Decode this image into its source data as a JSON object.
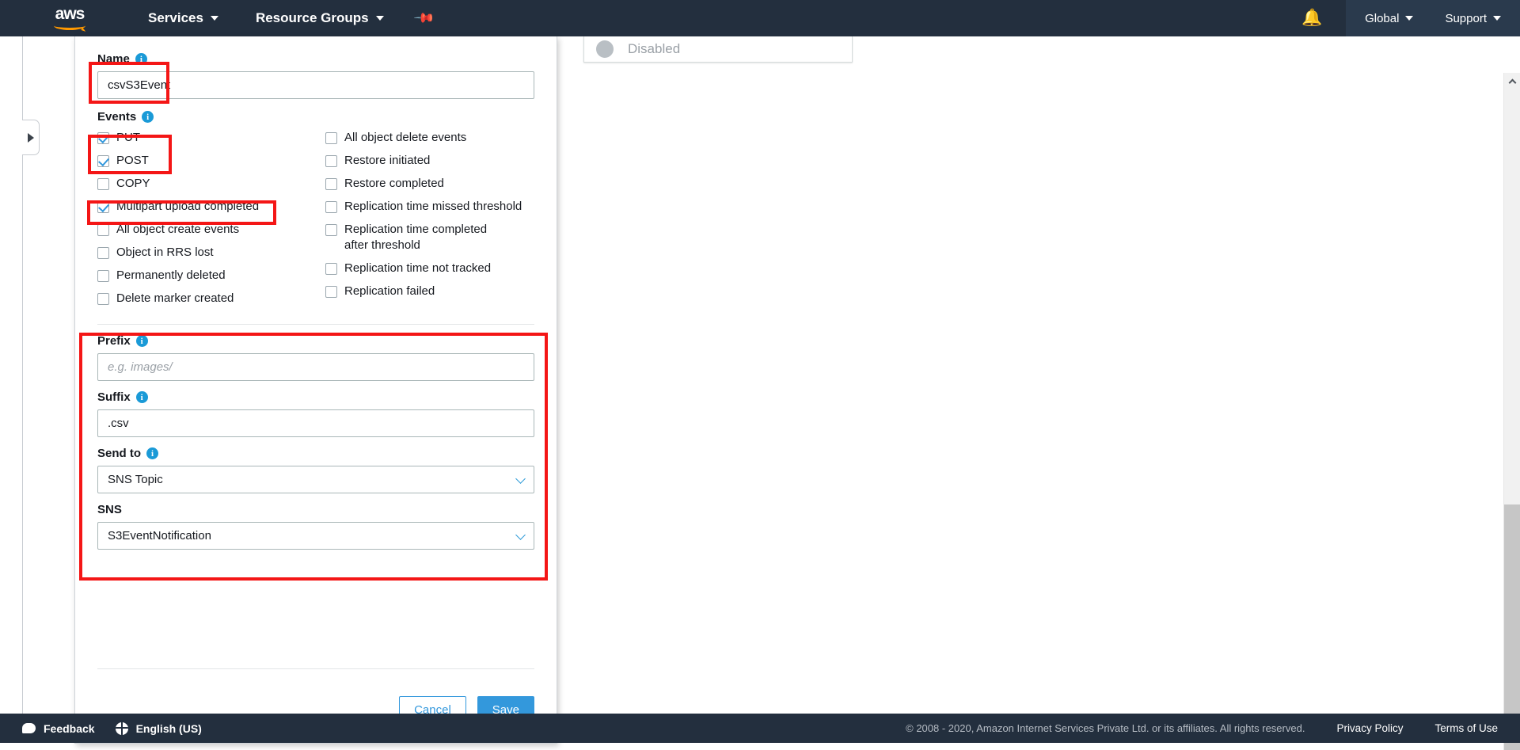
{
  "navbar": {
    "logo_text": "aws",
    "services_label": "Services",
    "resource_groups_label": "Resource Groups",
    "pin_icon": "pin-icon",
    "bell_icon": "bell-icon",
    "region_label": "Global",
    "support_label": "Support"
  },
  "status_panel": {
    "label": "Disabled"
  },
  "panel": {
    "name": {
      "label": "Name",
      "value": "csvS3Event",
      "info_icon": "info-icon"
    },
    "events": {
      "label": "Events",
      "info_icon": "info-icon",
      "left_column": [
        {
          "label": "PUT",
          "checked": true
        },
        {
          "label": "POST",
          "checked": true
        },
        {
          "label": "COPY",
          "checked": false
        },
        {
          "label": "Multipart upload completed",
          "checked": true
        },
        {
          "label": "All object create events",
          "checked": false
        },
        {
          "label": "Object in RRS lost",
          "checked": false
        },
        {
          "label": "Permanently deleted",
          "checked": false
        },
        {
          "label": "Delete marker created",
          "checked": false
        }
      ],
      "right_column": [
        {
          "label": "All object delete events",
          "checked": false,
          "two_line": false
        },
        {
          "label": "Restore initiated",
          "checked": false,
          "two_line": false
        },
        {
          "label": "Restore completed",
          "checked": false,
          "two_line": false
        },
        {
          "label": "Replication time missed threshold",
          "checked": false,
          "two_line": false
        },
        {
          "label": "Replication time completed after threshold",
          "checked": false,
          "two_line": true
        },
        {
          "label": "Replication time not tracked",
          "checked": false,
          "two_line": false
        },
        {
          "label": "Replication failed",
          "checked": false,
          "two_line": false
        }
      ]
    },
    "prefix": {
      "label": "Prefix",
      "placeholder": "e.g. images/",
      "value": ""
    },
    "suffix": {
      "label": "Suffix",
      "value": ".csv"
    },
    "send_to": {
      "label": "Send to",
      "value": "SNS Topic"
    },
    "sns": {
      "label": "SNS",
      "value": "S3EventNotification"
    },
    "actions": {
      "cancel_label": "Cancel",
      "save_label": "Save"
    }
  },
  "footer": {
    "feedback_label": "Feedback",
    "language_label": "English (US)",
    "copyright": "© 2008 - 2020, Amazon Internet Services Private Ltd. or its affiliates. All rights reserved.",
    "privacy_label": "Privacy Policy",
    "terms_label": "Terms of Use"
  },
  "colors": {
    "nav_background": "#232f3e",
    "accent_blue": "#3398dc",
    "info_blue": "#1a9ad7",
    "annotation_red": "#f41616",
    "aws_orange": "#ff9900"
  }
}
